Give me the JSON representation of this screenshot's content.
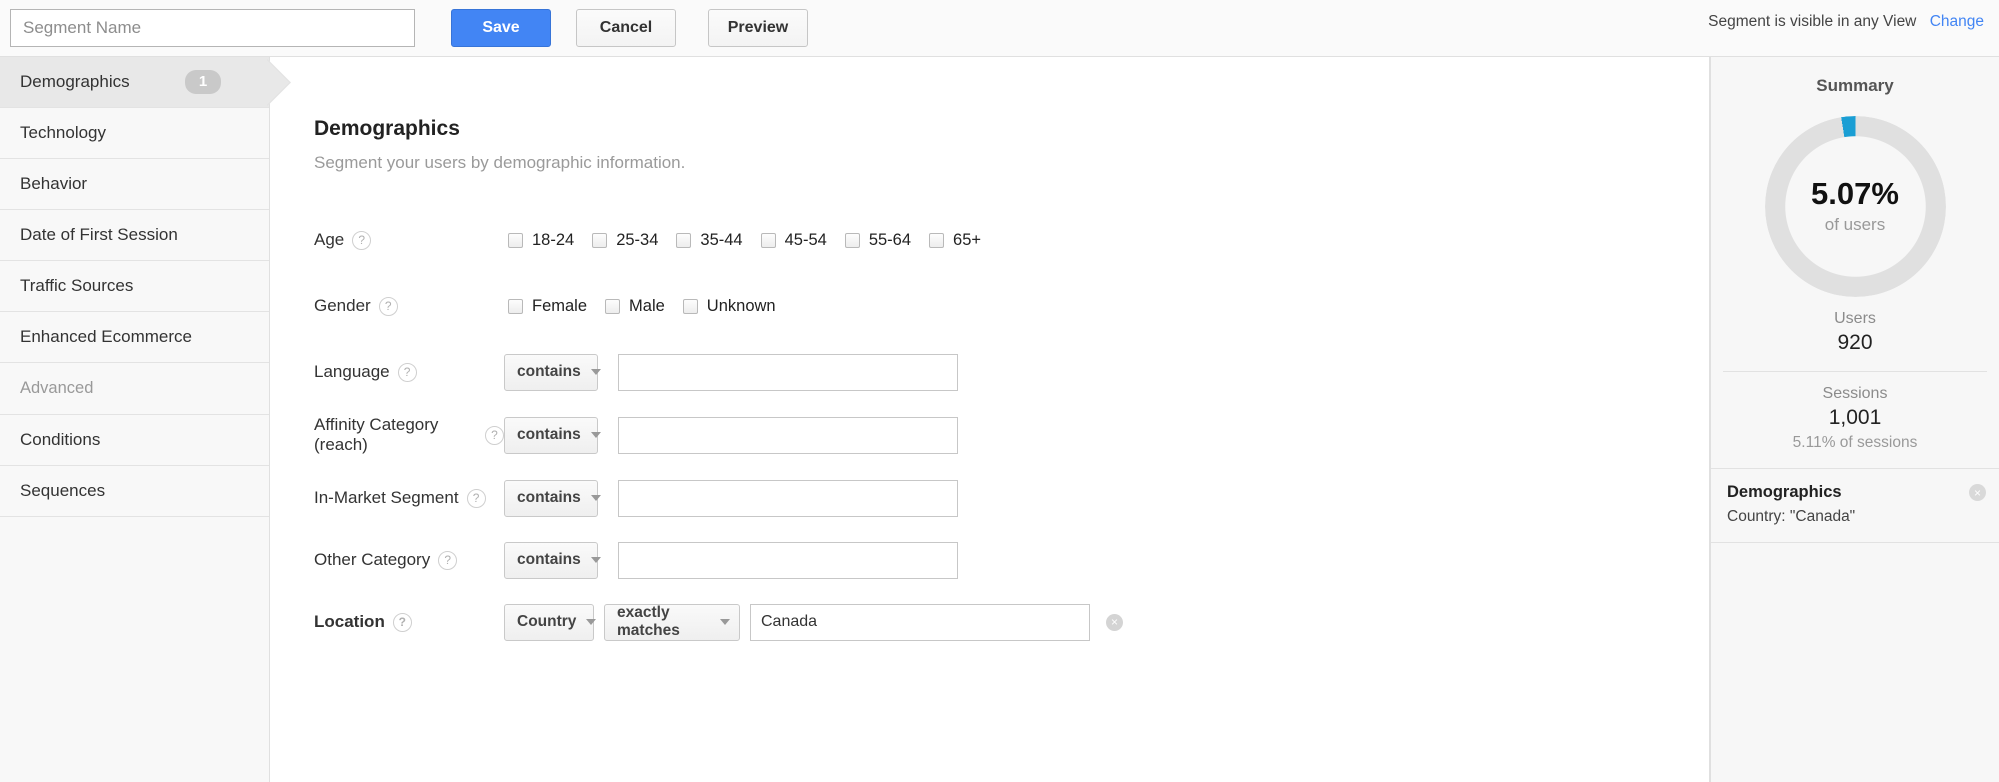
{
  "topbar": {
    "segment_name_placeholder": "Segment Name",
    "segment_name_value": "",
    "save_label": "Save",
    "cancel_label": "Cancel",
    "preview_label": "Preview",
    "visibility_text": "Segment is visible in any View",
    "change_label": "Change"
  },
  "sidebar": {
    "items": [
      {
        "label": "Demographics",
        "badge": "1",
        "active": true
      },
      {
        "label": "Technology",
        "badge": "",
        "active": false
      },
      {
        "label": "Behavior",
        "badge": "",
        "active": false
      },
      {
        "label": "Date of First Session",
        "badge": "",
        "active": false
      },
      {
        "label": "Traffic Sources",
        "badge": "",
        "active": false
      },
      {
        "label": "Enhanced Ecommerce",
        "badge": "",
        "active": false
      }
    ],
    "advanced_label": "Advanced",
    "advanced_items": [
      {
        "label": "Conditions"
      },
      {
        "label": "Sequences"
      }
    ]
  },
  "main": {
    "title": "Demographics",
    "subtitle": "Segment your users by demographic information.",
    "help_glyph": "?",
    "age": {
      "label": "Age",
      "options": [
        "18-24",
        "25-34",
        "35-44",
        "45-54",
        "55-64",
        "65+"
      ]
    },
    "gender": {
      "label": "Gender",
      "options": [
        "Female",
        "Male",
        "Unknown"
      ]
    },
    "language": {
      "label": "Language",
      "operator": "contains",
      "value": "",
      "placeholder": ""
    },
    "affinity": {
      "label": "Affinity Category (reach)",
      "operator": "contains",
      "value": "",
      "placeholder": ""
    },
    "in_market": {
      "label": "In-Market Segment",
      "operator": "contains",
      "value": "",
      "placeholder": ""
    },
    "other_category": {
      "label": "Other Category",
      "operator": "contains",
      "value": "",
      "placeholder": ""
    },
    "location": {
      "label": "Location",
      "dimension": "Country",
      "operator": "exactly matches",
      "value": "Canada",
      "remove_glyph": "×"
    }
  },
  "summary": {
    "title": "Summary",
    "percent": "5.07%",
    "percent_sub": "of users",
    "donut_percent_value": 5.07,
    "accent_color": "#1a9ed4",
    "track_color": "#e0e0e0",
    "users_label": "Users",
    "users_value": "920",
    "sessions_label": "Sessions",
    "sessions_value": "1,001",
    "sessions_note": "5.11% of sessions",
    "card": {
      "title": "Demographics",
      "line": "Country: \"Canada\"",
      "close_glyph": "×"
    }
  }
}
